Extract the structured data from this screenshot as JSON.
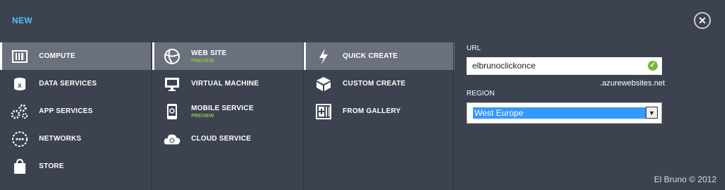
{
  "header": {
    "title": "NEW",
    "close_icon": "close-icon"
  },
  "categories": [
    {
      "label": "COMPUTE",
      "icon": "compute-icon",
      "selected": true
    },
    {
      "label": "DATA SERVICES",
      "icon": "data-services-icon",
      "selected": false
    },
    {
      "label": "APP SERVICES",
      "icon": "app-services-icon",
      "selected": false
    },
    {
      "label": "NETWORKS",
      "icon": "networks-icon",
      "selected": false
    },
    {
      "label": "STORE",
      "icon": "store-icon",
      "selected": false
    }
  ],
  "compute_items": [
    {
      "label": "WEB SITE",
      "sub": "PREVIEW",
      "icon": "globe-icon",
      "selected": true
    },
    {
      "label": "VIRTUAL MACHINE",
      "sub": "",
      "icon": "monitor-icon",
      "selected": false
    },
    {
      "label": "MOBILE SERVICE",
      "sub": "PREVIEW",
      "icon": "mobile-icon",
      "selected": false
    },
    {
      "label": "CLOUD SERVICE",
      "sub": "",
      "icon": "cloud-gear-icon",
      "selected": false
    }
  ],
  "create_options": [
    {
      "label": "QUICK CREATE",
      "icon": "lightning-icon",
      "selected": true
    },
    {
      "label": "CUSTOM CREATE",
      "icon": "cube-icon",
      "selected": false
    },
    {
      "label": "FROM GALLERY",
      "icon": "gallery-icon",
      "selected": false
    }
  ],
  "form": {
    "url_label": "URL",
    "url_value": "elbrunoclickonce",
    "url_suffix": ".azurewebsites.net",
    "region_label": "REGION",
    "region_value": "West Europe"
  },
  "watermark": "El Bruno © 2012",
  "colors": {
    "accent": "#4fc3f7",
    "preview": "#8bc34a",
    "selected_bg": "#6b717c",
    "background": "#3c4250"
  }
}
